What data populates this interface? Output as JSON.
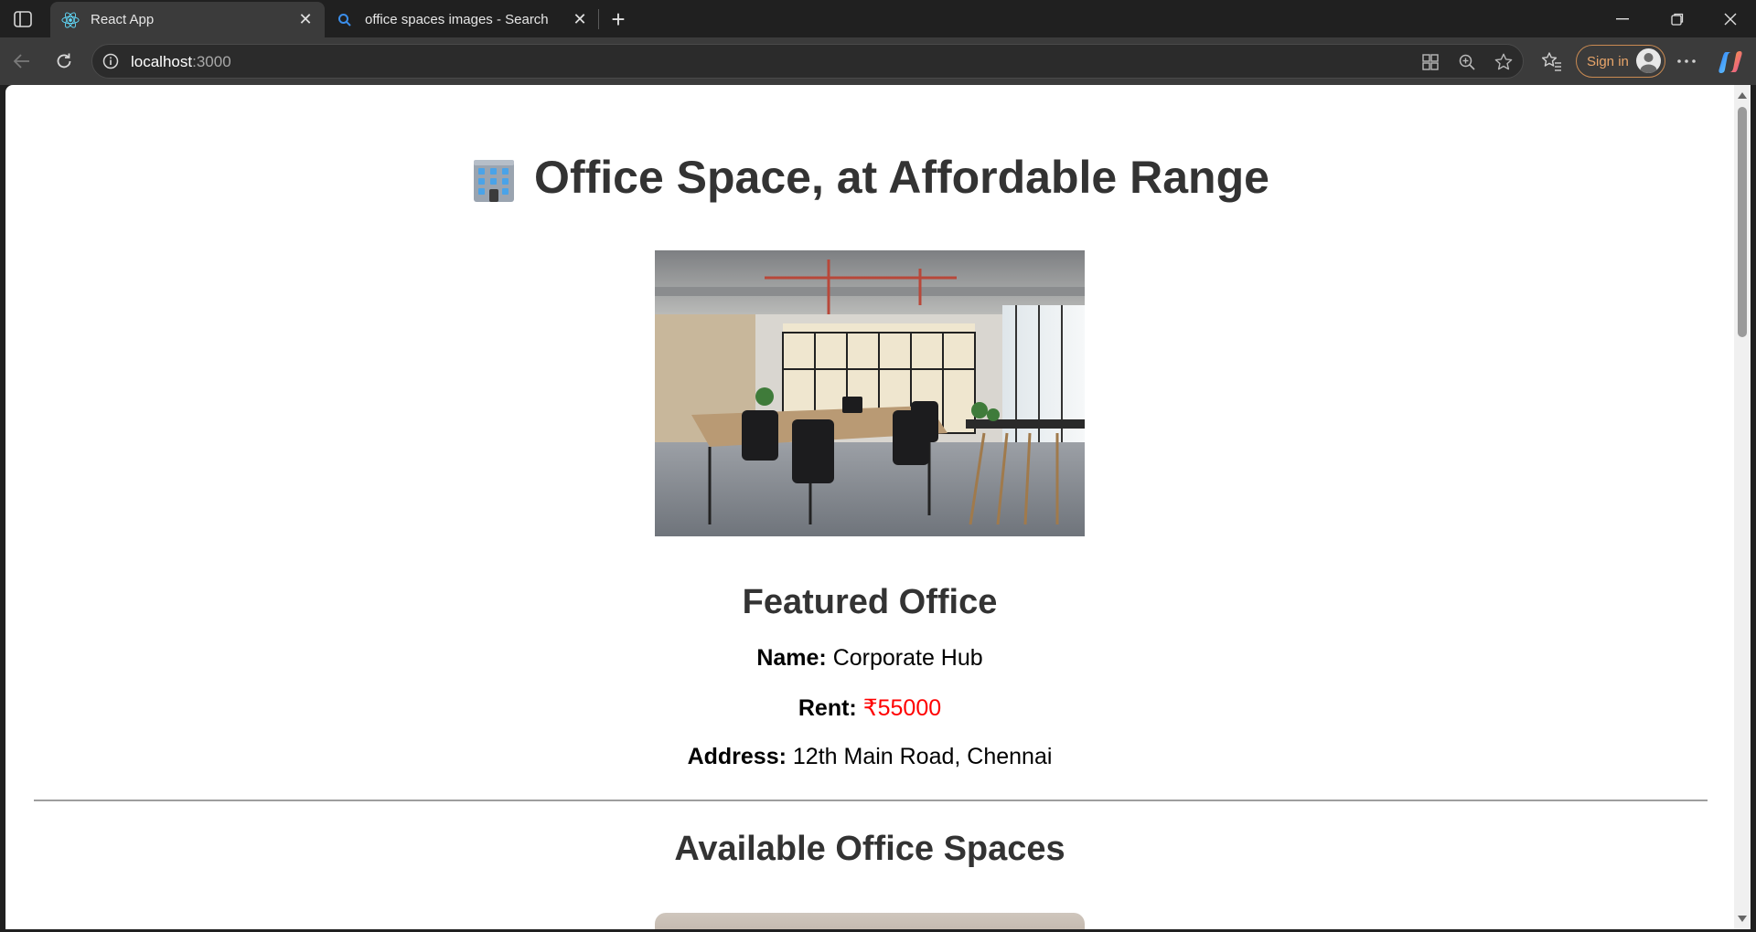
{
  "browser": {
    "tabs": [
      {
        "title": "React App",
        "active": true,
        "icon": "react-icon"
      },
      {
        "title": "office spaces images - Search",
        "active": false,
        "icon": "search-icon"
      }
    ],
    "url_host": "localhost",
    "url_port": ":3000",
    "signin_label": "Sign in"
  },
  "page": {
    "title_emoji": "office-building-icon",
    "title": "Office Space, at Affordable Range",
    "featured_heading": "Featured Office",
    "name_label": "Name:",
    "name_value": "Corporate Hub",
    "rent_label": "Rent:",
    "rent_value": "₹55000",
    "rent_color": "#ff0000",
    "address_label": "Address:",
    "address_value": "12th Main Road, Chennai",
    "available_heading": "Available Office Spaces"
  }
}
